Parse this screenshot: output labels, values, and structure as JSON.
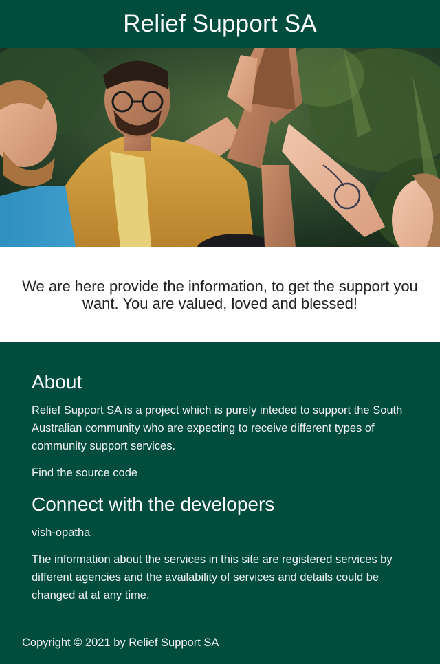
{
  "header": {
    "title": "Relief Support SA",
    "background": "#004d40"
  },
  "hero": {
    "image_description_icon": "people-high-five-photo"
  },
  "intro": {
    "text": "We are here provide the information, to get the support you want. You are valued, loved and blessed!"
  },
  "footer": {
    "background": "#004d40",
    "about": {
      "heading": "About",
      "description": "Relief Support SA is a project which is purely inteded to support the South Australian community who are expecting to receive different types of community support services.",
      "source_link": "Find the source code"
    },
    "connect": {
      "heading": "Connect with the developers",
      "developer_link": "vish-opatha",
      "disclaimer": "The information about the services in this site are registered services by different agencies and the availability of services and details could be changed at at any time."
    },
    "copyright": "Copyright © 2021 by Relief Support SA"
  }
}
